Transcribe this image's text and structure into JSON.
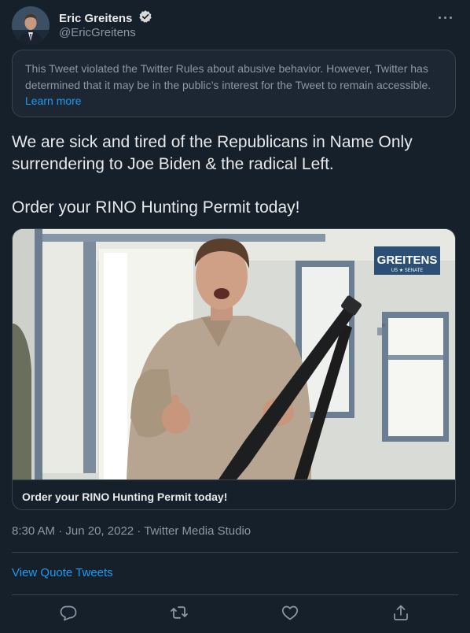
{
  "author": {
    "name": "Eric Greitens",
    "handle": "@EricGreitens",
    "verified_icon": "verified-badge-icon"
  },
  "notice": {
    "text": "This Tweet violated the Twitter Rules about abusive behavior. However, Twitter has determined that it may be in the public’s interest for the Tweet to remain accessible.",
    "link": "Learn more"
  },
  "tweet": {
    "line1": "We are sick and tired of the Republicans in Name Only surrendering to Joe Biden & the radical Left.",
    "line2": "Order your RINO Hunting Permit today!"
  },
  "card": {
    "logo_main": "GREITENS",
    "logo_sub": "US ★ SENATE",
    "title": "Order your RINO Hunting Permit today!"
  },
  "meta": {
    "time": "8:30 AM",
    "date": "Jun 20, 2022",
    "separator": "·",
    "source": "Twitter Media Studio"
  },
  "quote_tweets_link": "View Quote Tweets",
  "actions": [
    "reply-icon",
    "retweet-icon",
    "like-icon",
    "share-icon"
  ],
  "colors": {
    "background": "#15202b",
    "accent": "#1d9bf0",
    "secondary_text": "#8b98a5",
    "border": "#38444d"
  }
}
